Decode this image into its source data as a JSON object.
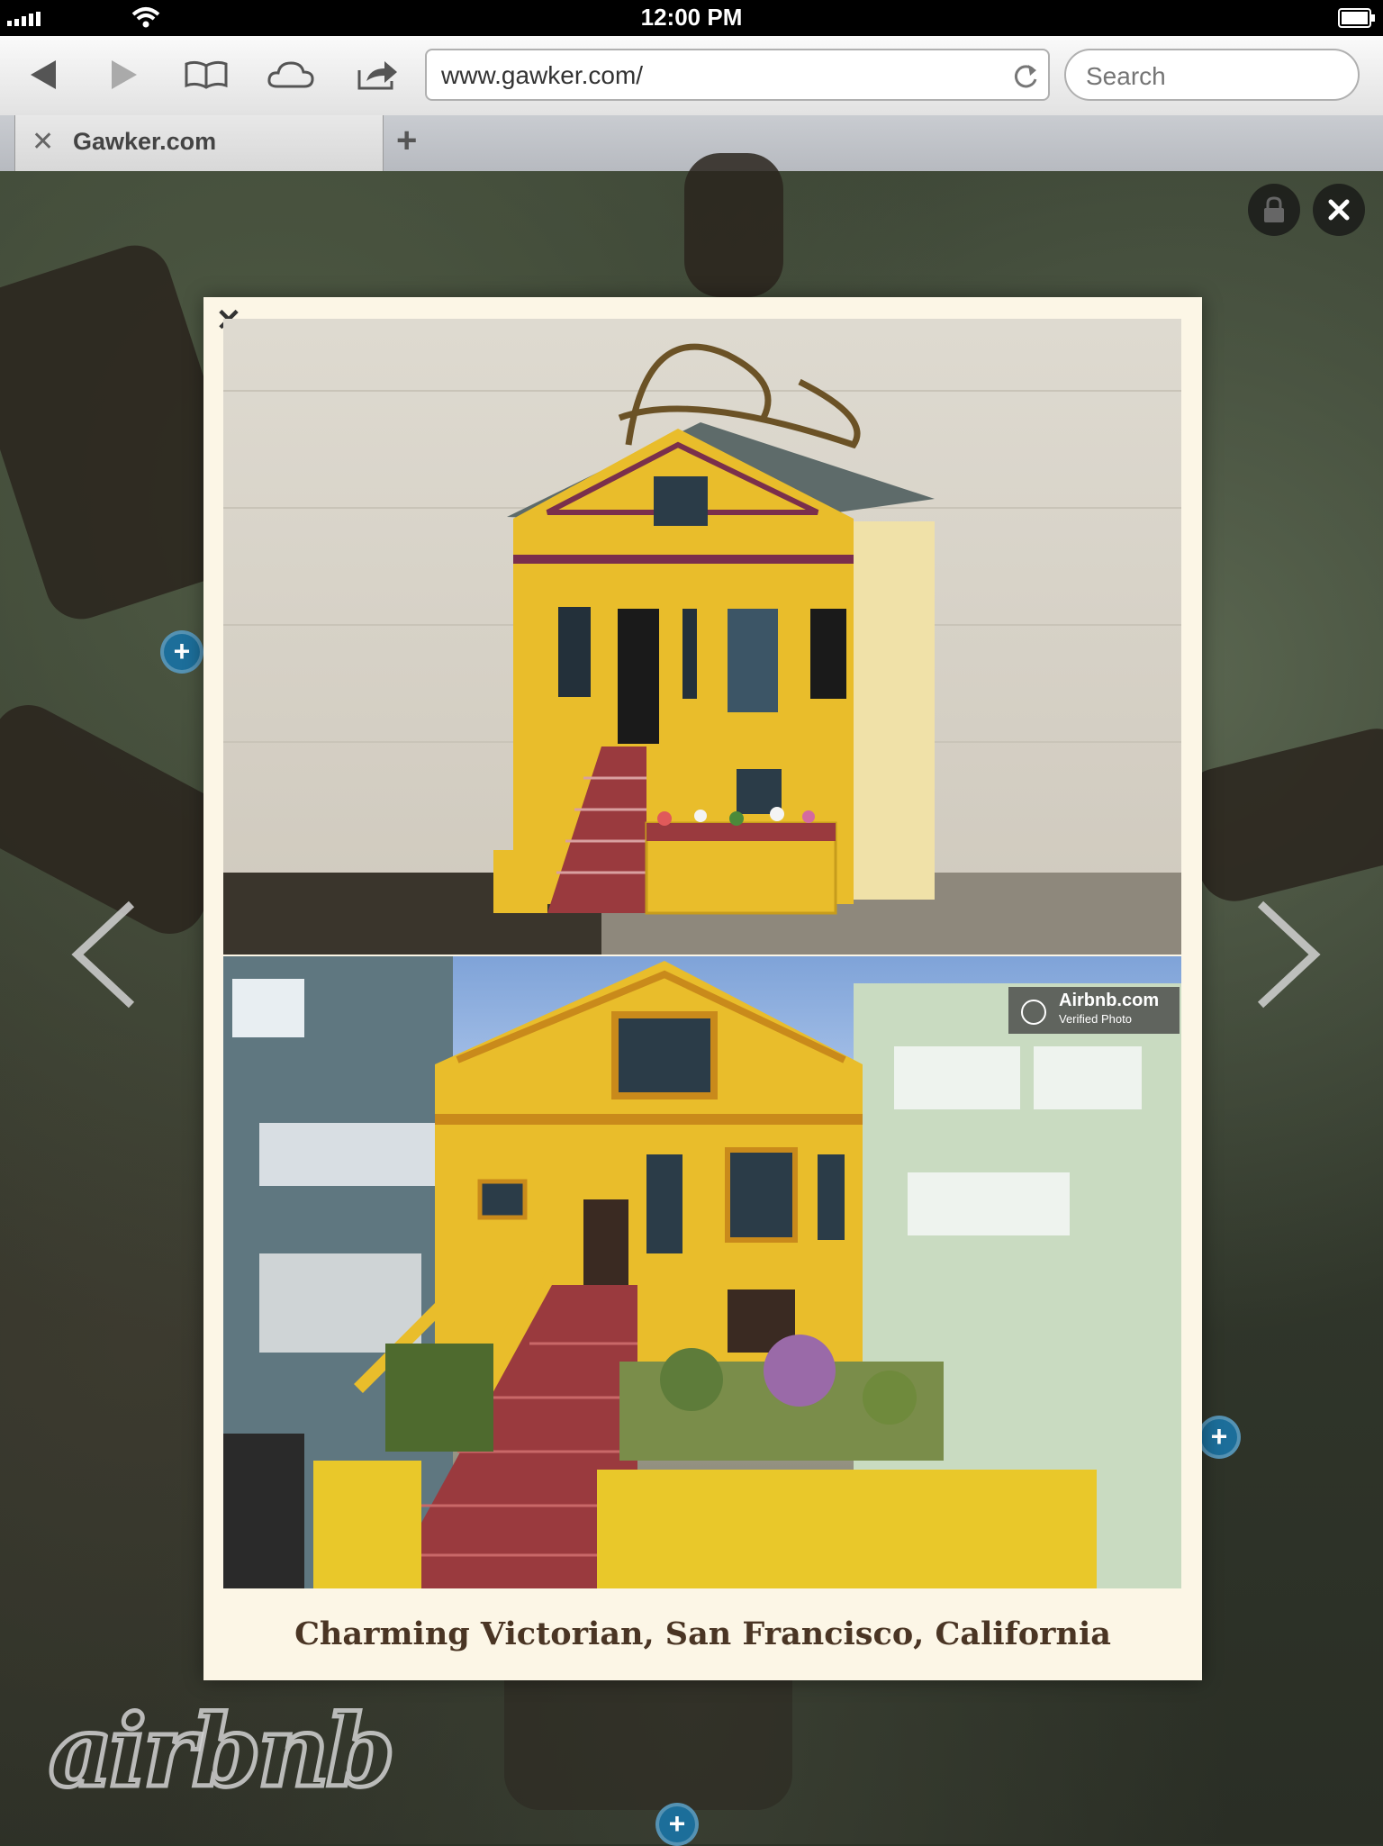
{
  "status_bar": {
    "time": "12:00 PM"
  },
  "toolbar": {
    "url": "www.gawker.com/",
    "search_placeholder": "Search",
    "icons": [
      "back-icon",
      "forward-icon",
      "bookmarks-icon",
      "icloud-icon",
      "share-icon",
      "reload-icon"
    ]
  },
  "tabs": [
    {
      "label": "Gawker.com"
    }
  ],
  "modal": {
    "caption": "Charming Victorian, San Francisco, California",
    "badge_title": "Airbnb.com",
    "badge_subtitle": "Verified Photo"
  },
  "page": {
    "logo": "airbnb"
  },
  "colors": {
    "accent_blue": "#1c6e9a",
    "house_yellow": "#e9bd2b",
    "stairs_red": "#9a3a3e"
  }
}
